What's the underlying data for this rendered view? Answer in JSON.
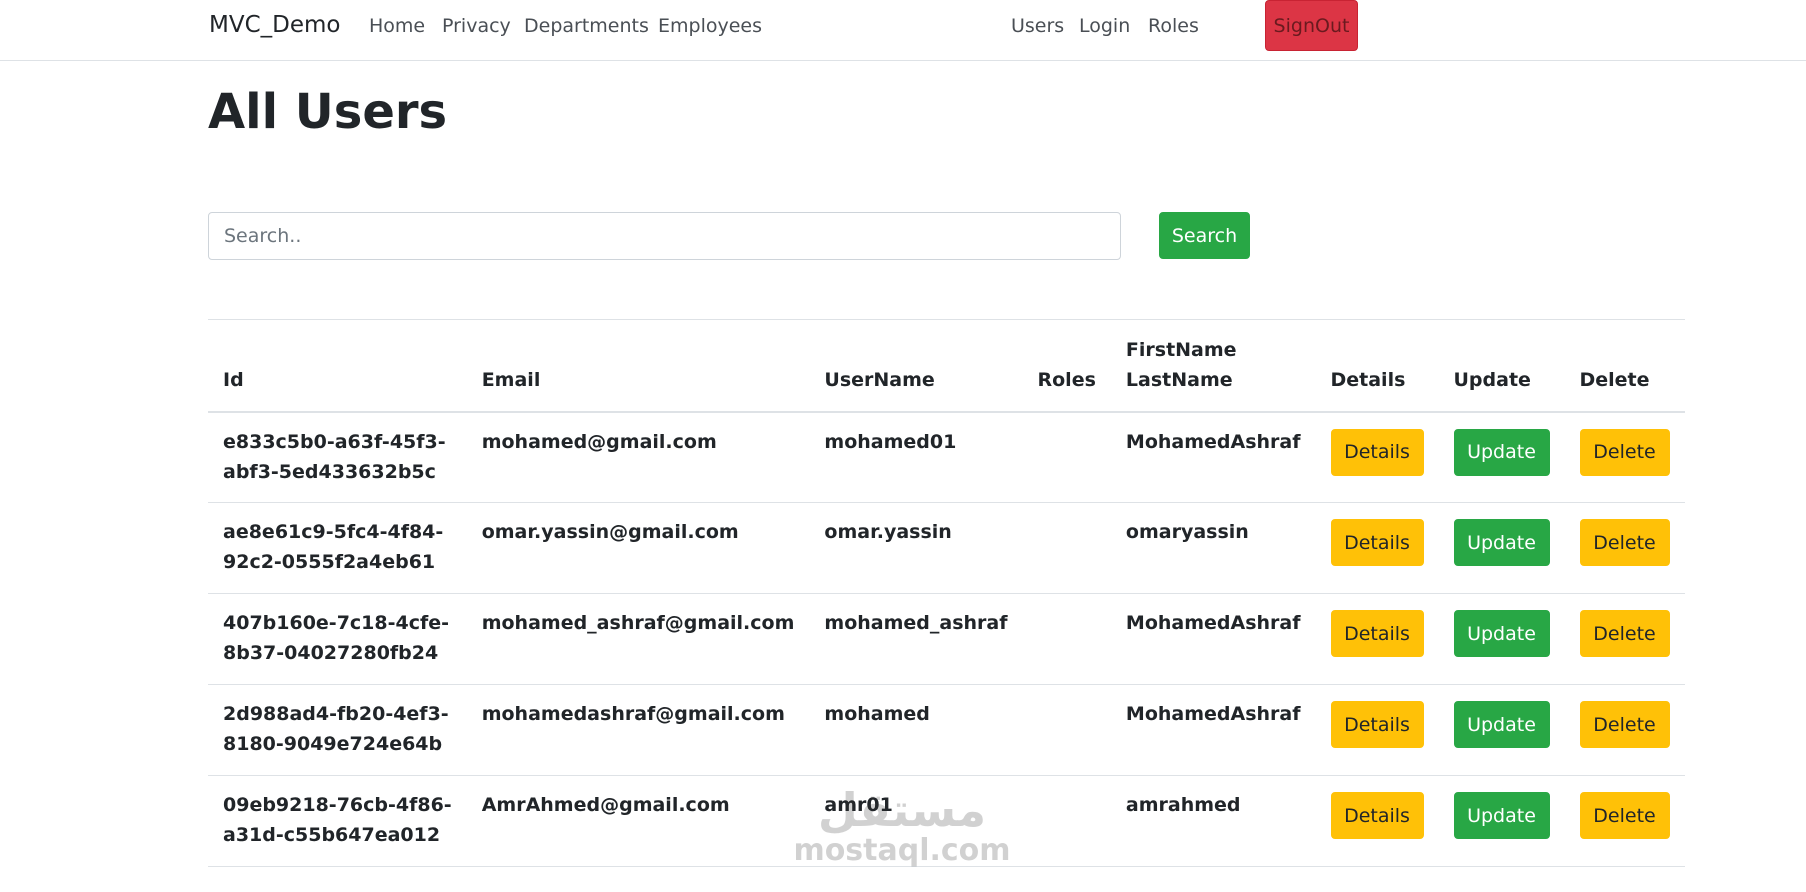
{
  "navbar": {
    "brand": "MVC_Demo",
    "links_left": [
      "Home",
      "Privacy",
      "Departments",
      "Employees"
    ],
    "links_right": [
      "Users",
      "Login",
      "Roles"
    ],
    "signout_label": "SignOut",
    "signout_color": "#dc3545"
  },
  "page": {
    "title": "All Users"
  },
  "search": {
    "placeholder": "Search..",
    "button_label": "Search",
    "button_color": "#28a745"
  },
  "table": {
    "headers": {
      "id": "Id",
      "email": "Email",
      "username": "UserName",
      "roles": "Roles",
      "firstname": "FirstName",
      "lastname": "LastName",
      "details": "Details",
      "update": "Update",
      "delete": "Delete"
    },
    "rows": [
      {
        "id_line1": "e833c5b0-a63f-45f3-",
        "id_line2": "abf3-5ed433632b5c",
        "email": "mohamed@gmail.com",
        "username": "mohamed01",
        "roles": "",
        "fullname": "MohamedAshraf"
      },
      {
        "id_line1": "ae8e61c9-5fc4-4f84-",
        "id_line2": "92c2-0555f2a4eb61",
        "email": "omar.yassin@gmail.com",
        "username": "omar.yassin",
        "roles": "",
        "fullname": "omaryassin"
      },
      {
        "id_line1": "407b160e-7c18-4cfe-",
        "id_line2": "8b37-04027280fb24",
        "email": "mohamed_ashraf@gmail.com",
        "username": "mohamed_ashraf",
        "roles": "",
        "fullname": "MohamedAshraf"
      },
      {
        "id_line1": "2d988ad4-fb20-4ef3-",
        "id_line2": "8180-9049e724e64b",
        "email": "mohamedashraf@gmail.com",
        "username": "mohamed",
        "roles": "",
        "fullname": "MohamedAshraf"
      },
      {
        "id_line1": "09eb9218-76cb-4f86-",
        "id_line2": "a31d-c55b647ea012",
        "email": "AmrAhmed@gmail.com",
        "username": "amr01",
        "roles": "",
        "fullname": "amrahmed"
      }
    ],
    "buttons": {
      "details": "Details",
      "update": "Update",
      "delete": "Delete"
    },
    "colors": {
      "warning": "#ffc107",
      "success": "#28a745"
    }
  },
  "watermark": {
    "arabic": "مستقل",
    "latin": "mostaql.com"
  }
}
